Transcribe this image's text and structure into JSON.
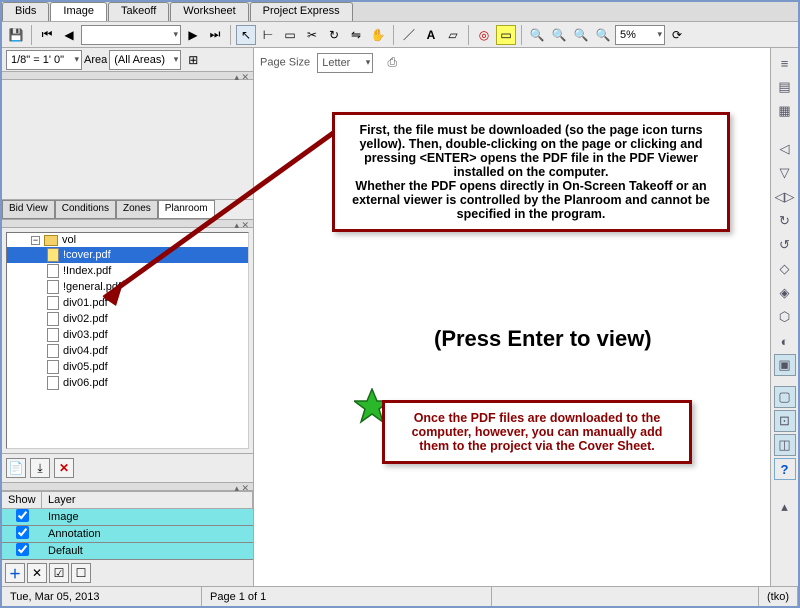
{
  "tabs": [
    "Bids",
    "Image",
    "Takeoff",
    "Worksheet",
    "Project Express"
  ],
  "active_tab": 1,
  "toolbar2": {
    "scale": "1/8\" = 1' 0\"",
    "area_label": "Area",
    "area_value": "(All Areas)",
    "page_size_label": "Page Size",
    "page_size_value": "Letter",
    "zoom": "5%"
  },
  "side_tabs": [
    "Bid View",
    "Conditions",
    "Zones",
    "Planroom"
  ],
  "side_tab_active": 3,
  "tree": {
    "folder": "vol",
    "files": [
      "!cover.pdf",
      "!Index.pdf",
      "!general.pdf",
      "div01.pdf",
      "div02.pdf",
      "div03.pdf",
      "div04.pdf",
      "div05.pdf",
      "div06.pdf"
    ],
    "selected": 0
  },
  "layers": {
    "cols": [
      "Show",
      "Layer"
    ],
    "rows": [
      "Image",
      "Annotation",
      "Default"
    ]
  },
  "callout1": "First, the file must be downloaded (so the page icon turns yellow).  Then, double-clicking on the page or clicking and pressing <ENTER> opens the PDF file in the PDF Viewer installed on the computer.\nWhether the PDF opens directly in On-Screen Takeoff or an external viewer is controlled by the Planroom and cannot be specified in the program.",
  "press_enter": "(Press Enter to view)",
  "callout2": "Once the PDF files are downloaded to the computer, however, you can manually add them to the project via the Cover Sheet.",
  "status": {
    "date": "Tue, Mar 05, 2013",
    "page": "Page 1 of 1",
    "user": "(tko)"
  },
  "icons": {
    "plus": "＋",
    "x": "✕",
    "check": "☑",
    "uncheck": "☐",
    "cursor": "↖",
    "hand": "✋",
    "text": "A",
    "eraser": "▱",
    "target": "◎",
    "highlight": "▭",
    "zoomin": "🔍",
    "refresh": "⟳",
    "help": "?",
    "print": "⎙",
    "grid": "▦"
  }
}
